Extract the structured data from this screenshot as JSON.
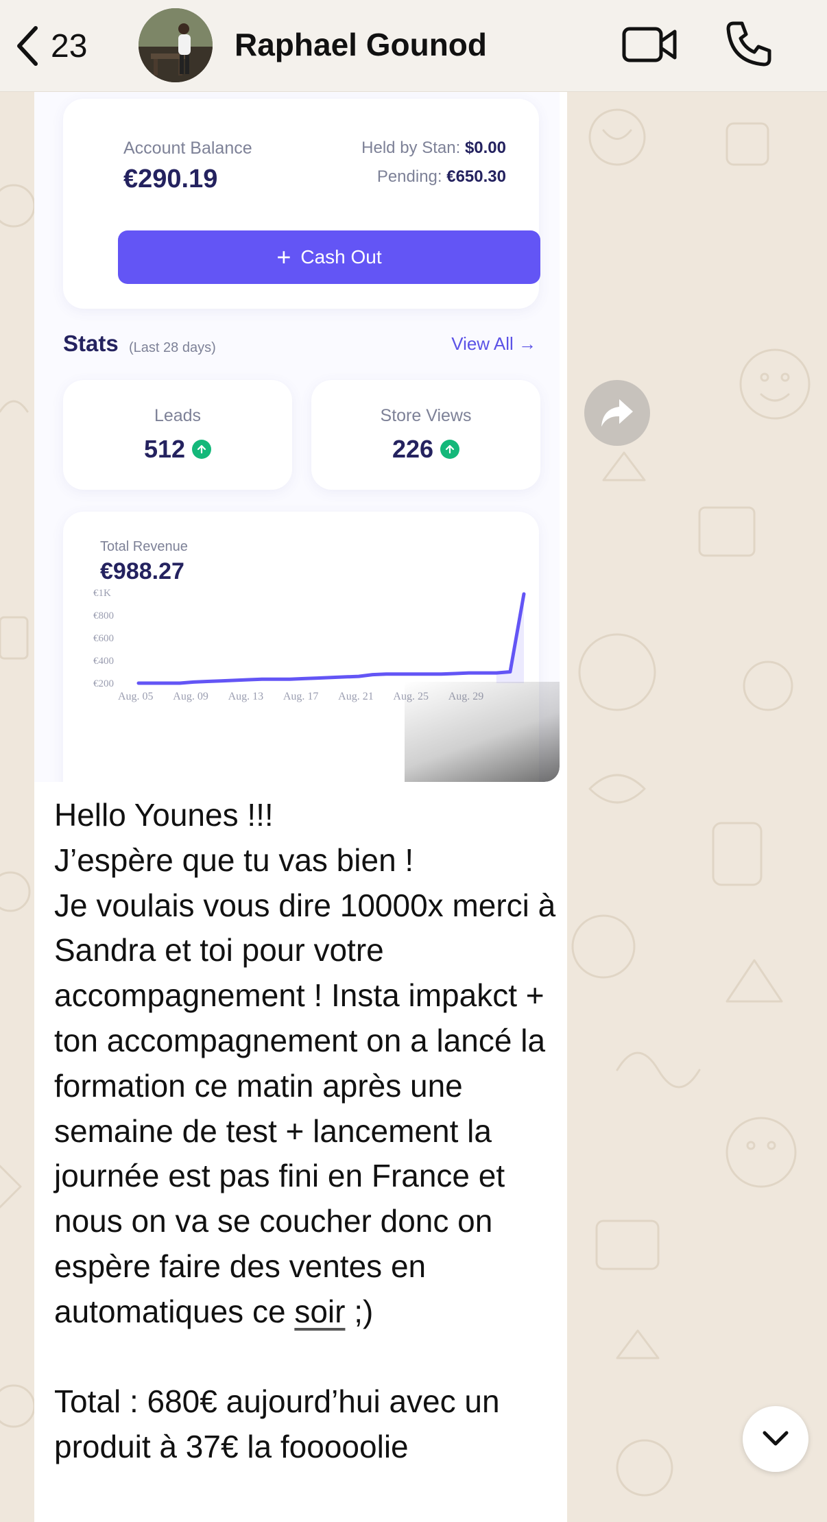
{
  "header": {
    "back_count": "23",
    "contact_name": "Raphael Gounod"
  },
  "shared_screenshot": {
    "account_balance_label": "Account Balance",
    "account_balance_value": "€290.19",
    "held_label": "Held by Stan:",
    "held_value": "$0.00",
    "pending_label": "Pending:",
    "pending_value": "€650.30",
    "cashout_label": "Cash Out",
    "stats_title": "Stats",
    "stats_range": "(Last 28 days)",
    "view_all_label": "View All →",
    "leads_label": "Leads",
    "leads_value": "512",
    "store_views_label": "Store Views",
    "store_views_value": "226",
    "revenue_label": "Total Revenue",
    "revenue_value": "€988.27"
  },
  "chart_data": {
    "type": "line",
    "title": "Total Revenue",
    "x": [
      "Aug. 05",
      "Aug. 06",
      "Aug. 07",
      "Aug. 08",
      "Aug. 09",
      "Aug. 10",
      "Aug. 11",
      "Aug. 12",
      "Aug. 13",
      "Aug. 14",
      "Aug. 15",
      "Aug. 16",
      "Aug. 17",
      "Aug. 18",
      "Aug. 19",
      "Aug. 20",
      "Aug. 21",
      "Aug. 22",
      "Aug. 23",
      "Aug. 24",
      "Aug. 25",
      "Aug. 26",
      "Aug. 27",
      "Aug. 28",
      "Aug. 29",
      "Aug. 30",
      "Aug. 31",
      "Sep. 01",
      "Sep. 02"
    ],
    "values": [
      200,
      200,
      200,
      200,
      210,
      215,
      220,
      225,
      230,
      235,
      235,
      235,
      240,
      245,
      250,
      255,
      260,
      275,
      280,
      280,
      280,
      280,
      280,
      285,
      290,
      290,
      290,
      300,
      988
    ],
    "x_ticks": [
      "Aug. 05",
      "Aug. 09",
      "Aug. 13",
      "Aug. 17",
      "Aug. 21",
      "Aug. 25",
      "Aug. 29"
    ],
    "y_ticks": [
      "€200",
      "€400",
      "€600",
      "€800",
      "€1K"
    ],
    "ylim": [
      200,
      1000
    ],
    "series_color": "#6355f5",
    "grid": false
  },
  "message": {
    "line1": "Hello Younes !!!",
    "line2": "J’espère que tu vas bien !",
    "body": "Je voulais vous dire 10000x merci à Sandra et toi pour votre accompagnement ! Insta impakct + ton accompagnement on a lancé la formation ce matin après une semaine de test + lancement la journée est pas fini en France et nous on va se coucher donc on espère faire des ventes en automatiques ce",
    "link_word": "soir",
    "after_link": " ;)",
    "total_line": "Total : 680€ aujourd’hui avec un produit à 37€ la fooooolie"
  },
  "colors": {
    "accent": "#6355f5",
    "navy": "#24225f",
    "success": "#14b87a",
    "wallpaper": "#efe7dc"
  },
  "icons": [
    "back-chevron-icon",
    "video-call-icon",
    "phone-icon",
    "forward-icon",
    "chevron-down-icon",
    "plus-icon",
    "arrow-up-icon"
  ]
}
